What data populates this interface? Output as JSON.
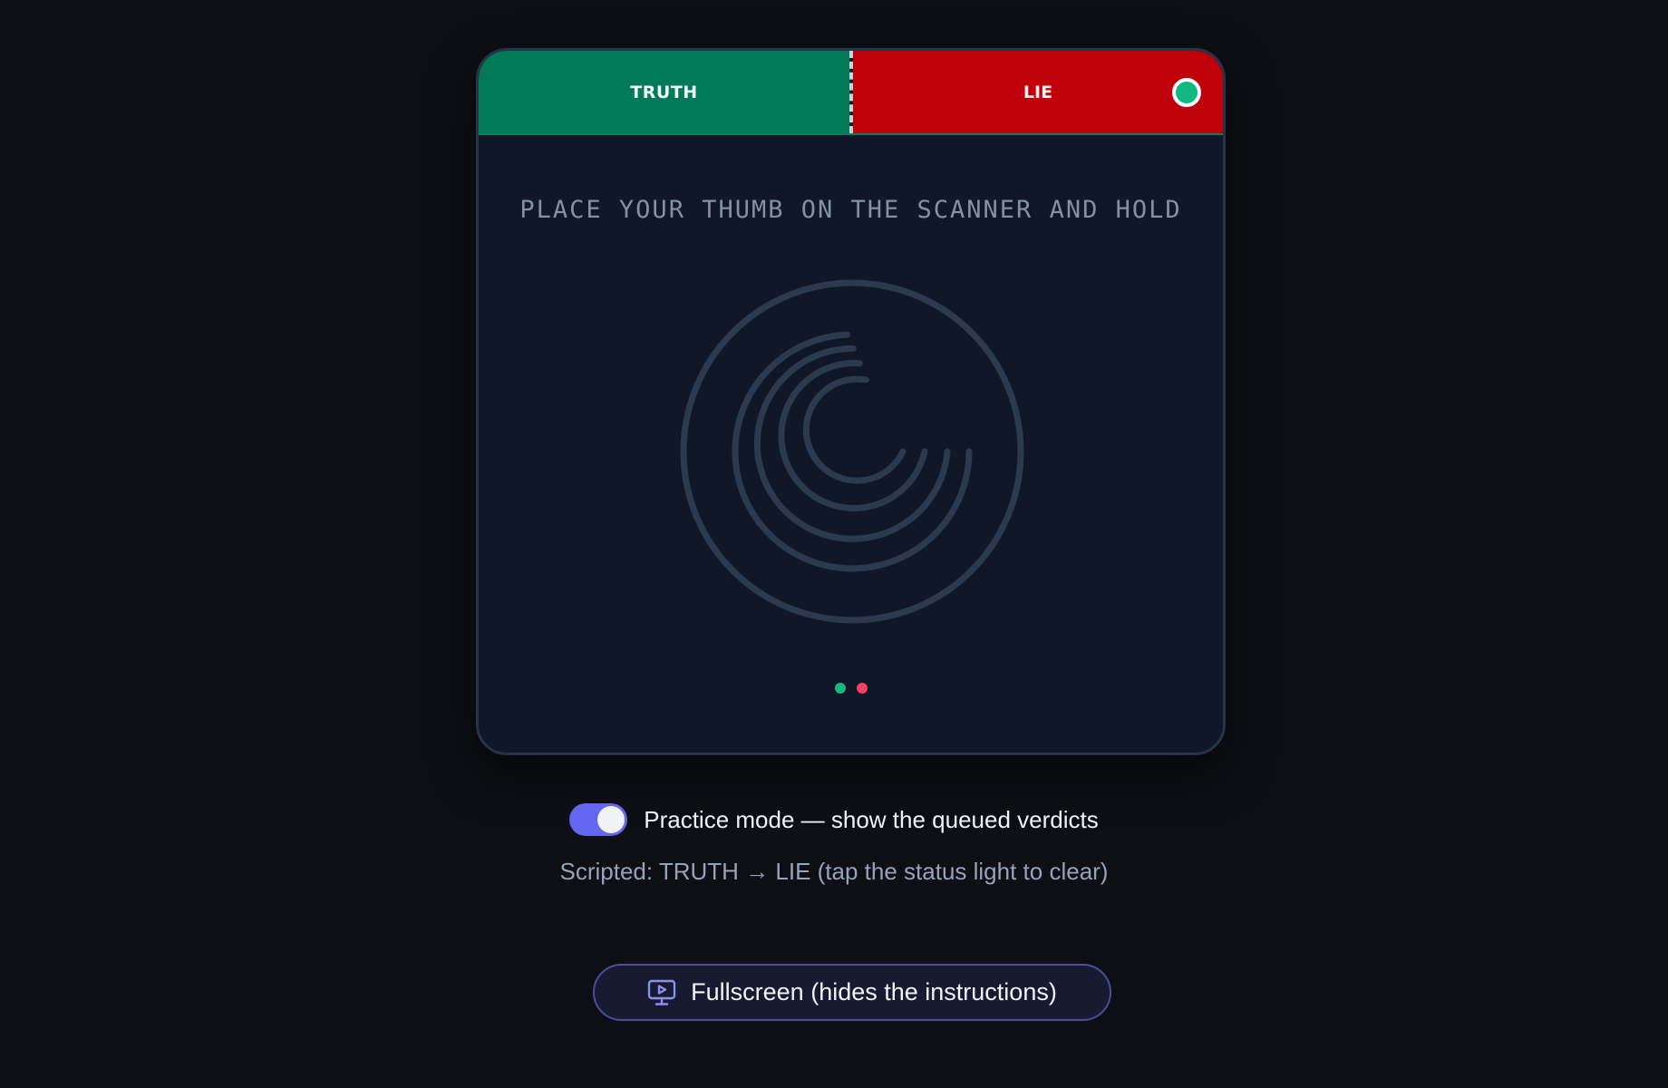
{
  "verdict_bar": {
    "truth_label": "TRUTH",
    "lie_label": "LIE",
    "status_light_color": "#10b981"
  },
  "scanner": {
    "instruction": "PLACE YOUR THUMB ON THE SCANNER AND HOLD",
    "icon": "fingerprint-icon",
    "queue_dots": [
      {
        "verdict": "TRUTH",
        "color": "#10b981"
      },
      {
        "verdict": "LIE",
        "color": "#f43f5e"
      }
    ]
  },
  "practice": {
    "toggle_on": true,
    "label": "Practice mode — show the queued verdicts",
    "scripted_text": "Scripted: TRUTH → LIE (tap the status light to clear)"
  },
  "fullscreen": {
    "icon": "presentation-screen-icon",
    "label": "Fullscreen (hides the instructions)"
  },
  "colors": {
    "truth": "#007a58",
    "lie": "#c0000a",
    "accent": "#6366f1",
    "background": "#0d0f14",
    "panel": "#0f1729"
  }
}
